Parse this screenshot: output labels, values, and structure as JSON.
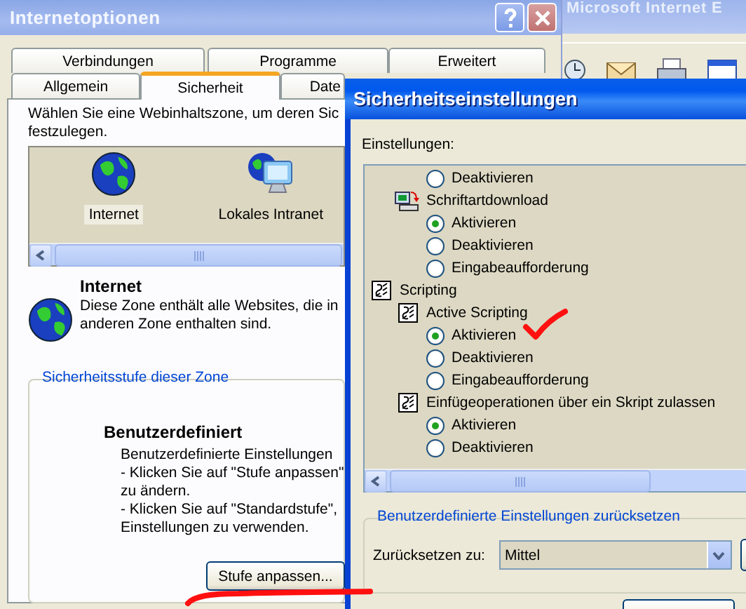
{
  "background_window": {
    "title": "Microsoft Internet E"
  },
  "options_dialog": {
    "title": "Internetoptionen",
    "tab_rows": [
      [
        {
          "label": "Verbindungen",
          "selected": false
        },
        {
          "label": "Programme",
          "selected": false
        },
        {
          "label": "Erweitert",
          "selected": false
        }
      ],
      [
        {
          "label": "Allgemein",
          "selected": false
        },
        {
          "label": "Sicherheit",
          "selected": true
        },
        {
          "label": "Date",
          "selected": false
        }
      ]
    ],
    "instruction": [
      "Wählen Sie eine Webinhaltszone, um deren Sic",
      "festzulegen."
    ],
    "zones": [
      {
        "label": "Internet",
        "kind": "internet",
        "selected": true
      },
      {
        "label": "Lokales Intranet",
        "kind": "intranet",
        "selected": false
      }
    ],
    "zone_info": {
      "title": "Internet",
      "description": [
        "Diese Zone enthält alle Websites, die in",
        "anderen Zone enthalten sind."
      ]
    },
    "security_level": {
      "group_label": "Sicherheitsstufe dieser Zone",
      "level_name": "Benutzerdefiniert",
      "description": [
        "Benutzerdefinierte Einstellungen",
        "- Klicken Sie auf \"Stufe anpassen\"",
        "zu ändern.",
        "- Klicken Sie auf \"Standardstufe\",",
        "Einstellungen zu verwenden."
      ],
      "button": "Stufe anpassen..."
    }
  },
  "settings_dialog": {
    "title": "Sicherheitseinstellungen",
    "list_label": "Einstellungen:",
    "items": [
      {
        "kind": "group",
        "children": [
          {
            "kind": "setting",
            "children": [
              {
                "kind": "option",
                "label": "Deaktivieren",
                "selected": false
              }
            ]
          },
          {
            "kind": "download",
            "label": "Schriftartdownload",
            "children": [
              {
                "kind": "option",
                "label": "Aktivieren",
                "selected": true
              },
              {
                "kind": "option",
                "label": "Deaktivieren",
                "selected": false
              },
              {
                "kind": "option",
                "label": "Eingabeaufforderung",
                "selected": false
              }
            ]
          }
        ]
      },
      {
        "kind": "group",
        "label": "Scripting",
        "children": [
          {
            "kind": "setting",
            "label": "Active Scripting",
            "children": [
              {
                "kind": "option",
                "label": "Aktivieren",
                "selected": true
              },
              {
                "kind": "option",
                "label": "Deaktivieren",
                "selected": false
              },
              {
                "kind": "option",
                "label": "Eingabeaufforderung",
                "selected": false
              }
            ]
          },
          {
            "kind": "setting",
            "label": "Einfügeoperationen über ein Skript zulassen",
            "children": [
              {
                "kind": "option",
                "label": "Aktivieren",
                "selected": true
              },
              {
                "kind": "option",
                "label": "Deaktivieren",
                "selected": false
              }
            ]
          }
        ]
      }
    ],
    "reset": {
      "group_label": "Benutzerdefinierte Einstellungen zurücksetzen",
      "label": "Zurücksetzen zu:",
      "value": "Mittel"
    }
  }
}
